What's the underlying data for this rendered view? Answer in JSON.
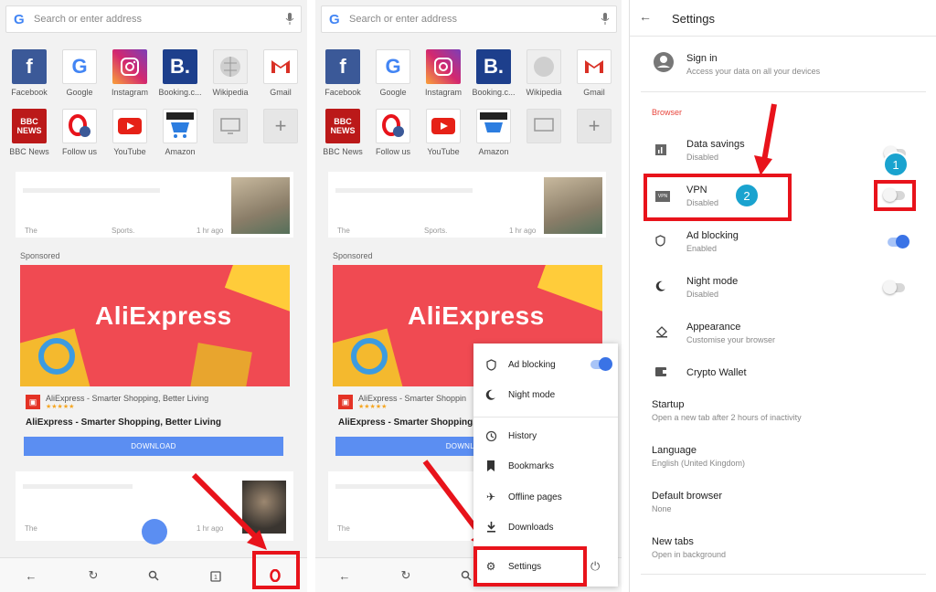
{
  "colors": {
    "accent_red": "#e8131b",
    "toggle_on": "#3a73e6",
    "badge_blue": "#1aa3cf"
  },
  "search": {
    "placeholder": "Search or enter address"
  },
  "speed_dial": [
    "Facebook",
    "Google",
    "Instagram",
    "Booking.c...",
    "Wikipedia",
    "Gmail",
    "BBC News",
    "Follow us",
    "YouTube",
    "Amazon"
  ],
  "news": {
    "top_source": "The",
    "top_category": "Sports.",
    "top_time": "1 hr ago",
    "bottom_source": "The",
    "bottom_time": "1 hr ago"
  },
  "ad": {
    "sponsored": "Sponsored",
    "brand": "AliExpress",
    "line": "AliExpress - Smarter Shopping, Better Living",
    "line_cut": "AliExpress - Smarter Shoppin",
    "stars": "★★★★★",
    "headline": "AliExpress - Smarter Shopping, Better Living",
    "headline_cut": "AliExpress - Smarter Shopping, Be",
    "download": "DOWNLOAD",
    "download_cut": "DOWNL"
  },
  "menu": {
    "ad_blocking": "Ad blocking",
    "night_mode": "Night mode",
    "history": "History",
    "bookmarks": "Bookmarks",
    "offline_pages": "Offline pages",
    "downloads": "Downloads",
    "settings": "Settings"
  },
  "settings": {
    "title": "Settings",
    "sign_in": "Sign in",
    "sign_in_sub": "Access your data on all your devices",
    "section_browser": "Browser",
    "data_savings": "Data savings",
    "data_savings_sub": "Disabled",
    "vpn": "VPN",
    "vpn_sub": "Disabled",
    "ad_blocking": "Ad blocking",
    "ad_blocking_sub": "Enabled",
    "night_mode": "Night mode",
    "night_mode_sub": "Disabled",
    "appearance": "Appearance",
    "appearance_sub": "Customise your browser",
    "crypto_wallet": "Crypto Wallet",
    "startup": "Startup",
    "startup_sub": "Open a new tab after 2 hours of inactivity",
    "language": "Language",
    "language_sub": "English (United Kingdom)",
    "default_browser": "Default browser",
    "default_browser_sub": "None",
    "new_tabs": "New tabs",
    "new_tabs_sub": "Open in background",
    "vpn_icon_text": "VPN"
  },
  "badges": {
    "one": "1",
    "two": "2"
  }
}
